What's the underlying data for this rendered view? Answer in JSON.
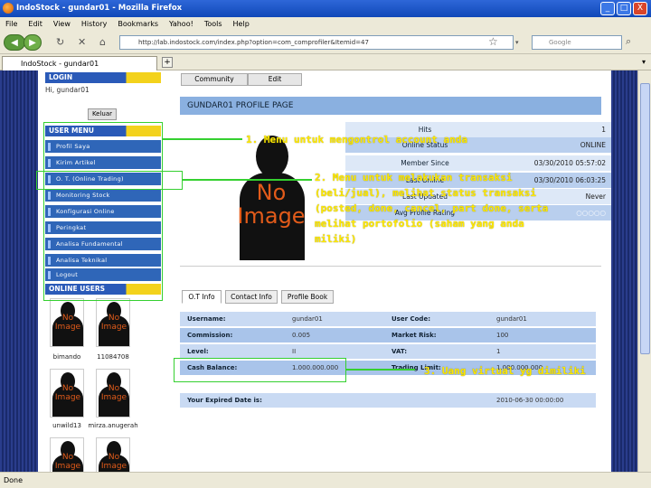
{
  "window": {
    "title": "IndoStock - gundar01 - Mozilla Firefox",
    "minimize": "_",
    "maximize": "□",
    "close": "X"
  },
  "menubar": [
    "File",
    "Edit",
    "View",
    "History",
    "Bookmarks",
    "Yahoo!",
    "Tools",
    "Help"
  ],
  "nav": {
    "url": "http://lab.indostock.com/index.php?option=com_comprofiler&Itemid=47",
    "search_placeholder": "Google"
  },
  "tab": {
    "label": "IndoStock - gundar01"
  },
  "status": "Done",
  "left": {
    "login_header": "LOGIN",
    "greeting": "Hi, gundar01",
    "logout_button": "Keluar",
    "user_menu_header": "USER MENU",
    "menu_items": [
      "Profil Saya",
      "Kirim Artikel",
      "O. T. (Online Trading)",
      "Monitoring Stock",
      "Konfigurasi Online",
      "Peringkat",
      "Analisa Fundamental",
      "Analisa Teknikal",
      "Logout"
    ],
    "online_users_header": "ONLINE USERS",
    "no_image": [
      "No",
      "Image"
    ],
    "users": [
      "bimando",
      "11084708",
      "unwild13",
      "mirza.anugerah"
    ]
  },
  "main": {
    "tabs": [
      "Community",
      "Edit"
    ],
    "profile_title": "GUNDAR01 PROFILE PAGE",
    "stats": [
      {
        "label": "Hits",
        "value": "1"
      },
      {
        "label": "Online Status",
        "value": "ONLINE"
      },
      {
        "label": "Member Since",
        "value": "03/30/2010 05:57:02"
      },
      {
        "label": "Last Online",
        "value": "03/30/2010 06:03:25"
      },
      {
        "label": "Last Updated",
        "value": "Never"
      },
      {
        "label": "Avg Profile Rating",
        "value": "○○○○○"
      }
    ],
    "profile_tabs": [
      "O.T Info",
      "Contact Info",
      "Profile Book"
    ],
    "info_rows": [
      {
        "k1": "Username:",
        "v1": "gundar01",
        "k2": "User Code:",
        "v2": "gundar01"
      },
      {
        "k1": "Commission:",
        "v1": "0.005",
        "k2": "Market Risk:",
        "v2": "100"
      },
      {
        "k1": "Level:",
        "v1": "II",
        "k2": "VAT:",
        "v2": "1"
      },
      {
        "k1": "Cash Balance:",
        "v1": "1.000.000.000",
        "k2": "Trading Limit:",
        "v2": "1.000.000.000"
      },
      {
        "k1": "Your Expired Date is:",
        "v1": "",
        "k2": "",
        "v2": "2010-06-30 00:00:00"
      }
    ]
  },
  "annotations": {
    "a1": "1. Menu untuk mengontrol account anda",
    "a2": [
      "2. Menu untuk melakukan transaksi",
      "(beli/jual), melihat status transaksi",
      "(posted, done, cancel, part done, serta",
      "melihat portofolio (saham yang anda",
      "miliki)"
    ],
    "a3": "3. Uang virtual yg dimiliki"
  },
  "colors": {
    "accent": "#2f66b8",
    "header_blue": "#8ab0e0",
    "annotation": "#ffe800",
    "highlight_box": "#35d030"
  }
}
